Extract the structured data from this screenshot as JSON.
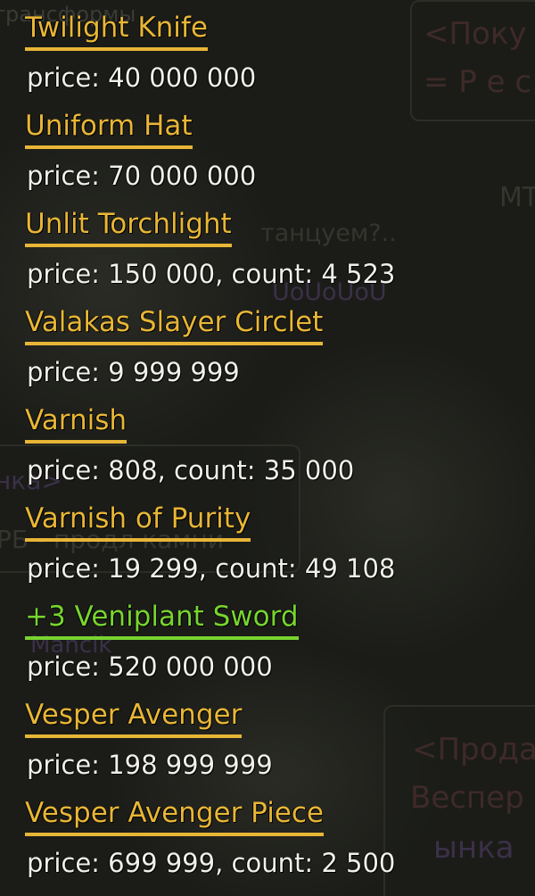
{
  "items": [
    {
      "name": "Twilight Knife",
      "info": "price: 40 000 000",
      "color": "#e8b636"
    },
    {
      "name": "Uniform Hat",
      "info": "price: 70 000 000",
      "color": "#e8b636"
    },
    {
      "name": "Unlit Torchlight",
      "info": "price: 150 000, count: 4 523",
      "color": "#e8b636"
    },
    {
      "name": "Valakas Slayer Circlet",
      "info": "price: 9 999 999",
      "color": "#e8b636"
    },
    {
      "name": "Varnish",
      "info": "price: 808, count: 35 000",
      "color": "#e8b636"
    },
    {
      "name": "Varnish of Purity",
      "info": "price: 19 299, count: 49 108",
      "color": "#e8b636"
    },
    {
      "name": "+3 Veniplant Sword",
      "info": "price: 520 000 000",
      "color": "#78d42f"
    },
    {
      "name": "Vesper Avenger",
      "info": "price: 198 999 999",
      "color": "#e8b636"
    },
    {
      "name": "Vesper Avenger Piece",
      "info": "price: 699 999, count: 2 500",
      "color": "#e8b636"
    }
  ],
  "background": {
    "top_left": "трансформы",
    "top_right_1": "<Поку",
    "top_right_2": "= Р е с",
    "right_mid": "MT",
    "center_1": "танцуем?..",
    "center_2": "UoUoUoU",
    "left_1": "нка>",
    "left_2": "РБ - продл камни",
    "left_3": "Mancik",
    "bottom_right_1": "<Прода",
    "bottom_right_2": "Веспер",
    "bottom_right_3": "ынка"
  }
}
